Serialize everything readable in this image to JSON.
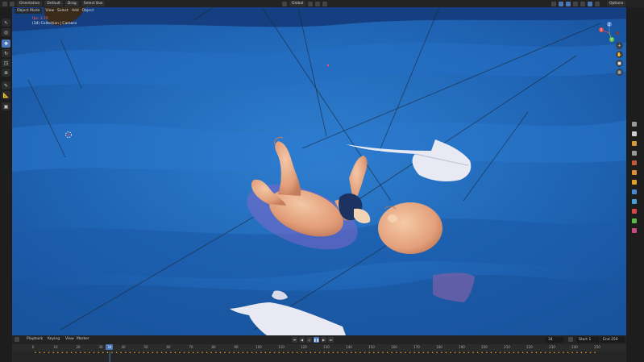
{
  "top_header": {
    "transform_label": "Orientation",
    "default_label": "Default",
    "drag_label": "Drag",
    "select_box_label": "Select Box",
    "global_label": "Global",
    "options_label": "Options"
  },
  "viewport_header": {
    "mode_label": "Object Mode",
    "menus": [
      "View",
      "Select",
      "Add",
      "Object"
    ]
  },
  "overlay": {
    "fps_label": "fps: 3.70",
    "collection_label": "(34) Collection | Camera"
  },
  "nav": {
    "zoom_icon": "+",
    "hand_icon": "✋",
    "camera_icon": "■",
    "grid_icon": "▦"
  },
  "gizmo": {
    "x": "X",
    "y": "Y",
    "z": "Z"
  },
  "timeline": {
    "playback_label": "Playback",
    "keying_label": "Keying",
    "view_label": "View",
    "marker_label": "Marker",
    "current_frame": "34",
    "frame_field": "34",
    "start_label": "Start",
    "start_value": "1",
    "end_label": "End",
    "end_value": "250",
    "ticks": [
      "0",
      "10",
      "20",
      "30",
      "40",
      "50",
      "60",
      "70",
      "80",
      "90",
      "100",
      "110",
      "120",
      "130",
      "140",
      "150",
      "160",
      "170",
      "180",
      "190",
      "200",
      "210",
      "220",
      "230",
      "240",
      "250"
    ]
  },
  "colors": {
    "accent": "#4a77b8",
    "water": "#1f5fb0",
    "keyframe": "#e6a21a"
  }
}
